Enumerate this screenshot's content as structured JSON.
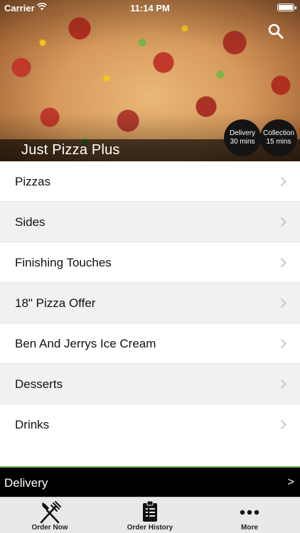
{
  "status_bar": {
    "carrier": "Carrier",
    "time": "11:14 PM"
  },
  "header": {
    "restaurant_name": "Just Pizza Plus",
    "search_icon": "search-icon",
    "delivery_badge": {
      "label": "Delivery",
      "time": "30 mins"
    },
    "collection_badge": {
      "label": "Collection",
      "time": "15 mins"
    }
  },
  "menu": {
    "items": [
      {
        "label": "Pizzas"
      },
      {
        "label": "Sides"
      },
      {
        "label": "Finishing Touches"
      },
      {
        "label": "18\" Pizza Offer"
      },
      {
        "label": "Ben And Jerrys Ice Cream"
      },
      {
        "label": "Desserts"
      },
      {
        "label": "Drinks"
      }
    ]
  },
  "order_mode": {
    "label": "Delivery",
    "arrow": ">",
    "accent_color": "#7db557"
  },
  "tabs": [
    {
      "label": "Order Now",
      "icon": "fork-knife-icon"
    },
    {
      "label": "Order History",
      "icon": "clipboard-icon"
    },
    {
      "label": "More",
      "icon": "more-dots-icon"
    }
  ]
}
